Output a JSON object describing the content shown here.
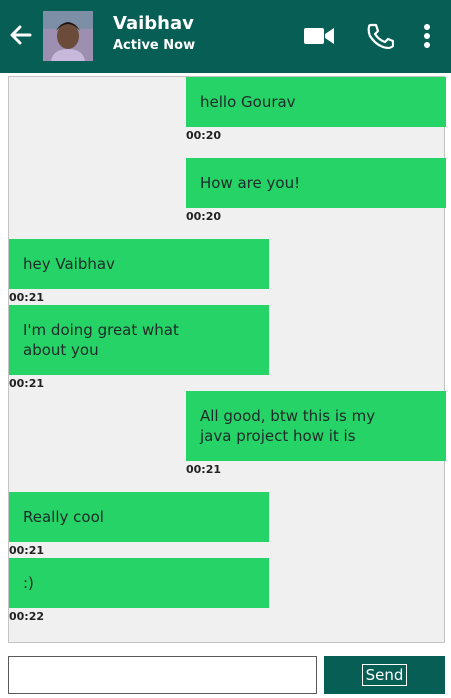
{
  "header": {
    "back_icon": "arrow-left-icon",
    "contact_name": "Vaibhav",
    "status": "Active Now",
    "video_icon": "video-camera-icon",
    "call_icon": "phone-icon",
    "menu_icon": "more-vertical-icon"
  },
  "messages": [
    {
      "side": "right",
      "text": "hello Gourav",
      "time": "00:20"
    },
    {
      "side": "right",
      "text": "How are you!",
      "time": "00:20"
    },
    {
      "side": "left",
      "text": "hey Vaibhav",
      "time": "00:21"
    },
    {
      "side": "left",
      "text": "I'm doing great what\nabout you",
      "time": "00:21"
    },
    {
      "side": "right",
      "text": "All good, btw this is my\njava project how it is",
      "time": "00:21"
    },
    {
      "side": "left",
      "text": "Really cool",
      "time": "00:21"
    },
    {
      "side": "left",
      "text": ":)",
      "time": "00:22"
    }
  ],
  "composer": {
    "value": "",
    "send_label": "Send"
  },
  "colors": {
    "header": "#075e54",
    "bubble": "#25d366",
    "chat_bg": "#f0f0f0"
  }
}
